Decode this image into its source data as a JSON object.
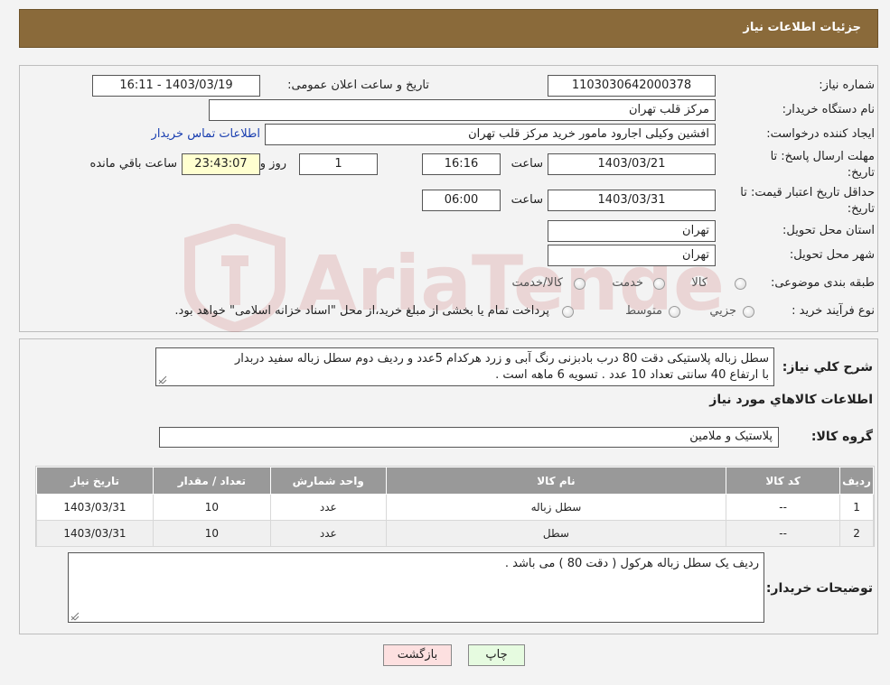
{
  "header": {
    "title": "جزئیات اطلاعات نیاز"
  },
  "form": {
    "need_number_label": "شماره نیاز:",
    "need_number": "1103030642000378",
    "announce_label": "تاریخ و ساعت اعلان عمومی:",
    "announce_value": "1403/03/19 - 16:11",
    "buyer_org_label": "نام دستگاه خریدار:",
    "buyer_org": "مرکز قلب تهران",
    "creator_label": "ایجاد کننده درخواست:",
    "creator": "افشین وکیلی اجارود مامور خرید مرکز قلب تهران",
    "contact_link": "اطلاعات تماس خریدار",
    "deadline_label_1": "مهلت ارسال پاسخ: تا",
    "deadline_label_2": "تاریخ:",
    "deadline_date": "1403/03/21",
    "time_label": "ساعت",
    "deadline_time": "16:16",
    "days_value": "1",
    "days_label": "روز و",
    "remaining_value": "23:43:07",
    "remaining_label": "ساعت باقي مانده",
    "validity_label_1": "حداقل تاریخ اعتبار قیمت: تا",
    "validity_label_2": "تاریخ:",
    "validity_date": "1403/03/31",
    "validity_time": "06:00",
    "province_label": "استان محل تحویل:",
    "province": "تهران",
    "city_label": "شهر محل تحویل:",
    "city": "تهران",
    "category_label": "طبقه بندی موضوعی:",
    "category_options": [
      "کالا",
      "خدمت",
      "کالا/خدمت"
    ],
    "process_label": "نوع فرآیند خرید :",
    "process_options": [
      "جزیي",
      "متوسط"
    ],
    "process_note": "پرداخت تمام یا بخشی از مبلغ خرید،از محل \"اسناد خزانه اسلامی\" خواهد بود."
  },
  "details": {
    "summary_label": "شرح کلي نیاز:",
    "summary_line1": "سطل زباله پلاستیکی دقت 80 درب بادبزنی رنگ آبی و زرد هرکدام 5عدد و ردیف دوم سطل زباله سفید دربدار",
    "summary_line2": "با ارتفاع 40 سانتی تعداد 10 عدد . تسویه 6 ماهه است .",
    "items_heading": "اطلاعات کالاهاي مورد نیاز",
    "group_label": "گروه کالا:",
    "group_value": "پلاستیک و ملامین",
    "table": {
      "headers": [
        "ردیف",
        "کد کالا",
        "نام کالا",
        "واحد شمارش",
        "تعداد / مقدار",
        "تاریخ نیاز"
      ],
      "rows": [
        [
          "1",
          "--",
          "سطل زباله",
          "عدد",
          "10",
          "1403/03/31"
        ],
        [
          "2",
          "--",
          "سطل",
          "عدد",
          "10",
          "1403/03/31"
        ]
      ]
    },
    "buyer_notes_label": "توضیحات خریدار:",
    "buyer_notes": "ردیف یک سطل زباله هرکول ( دقت 80 ) می باشد ."
  },
  "buttons": {
    "print": "چاپ",
    "back": "بازگشت"
  },
  "watermark_text": "AriaTender.neT",
  "colors": {
    "header": "#8a6a3a",
    "back_button": "#fde0e0",
    "print_button": "#e6fbe0",
    "link": "#1a3fb0"
  }
}
